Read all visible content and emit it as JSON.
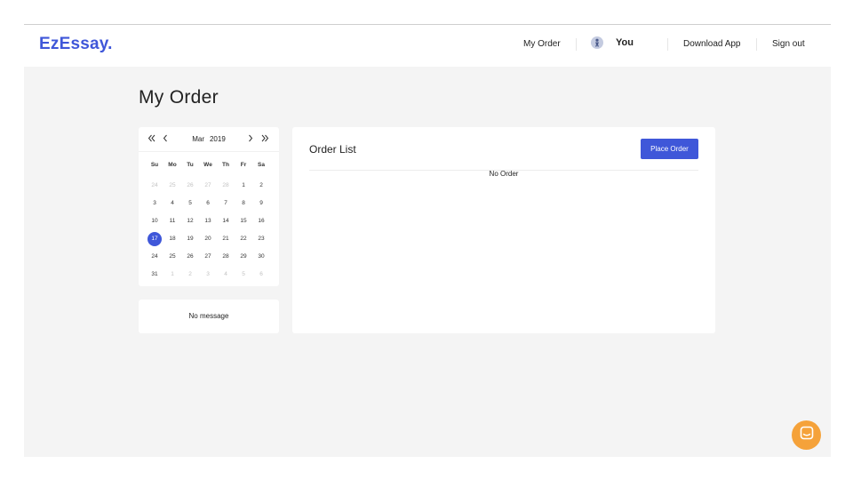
{
  "header": {
    "logo": "EzEssay.",
    "nav": {
      "my_order": "My Order",
      "user_name": "You",
      "download_app": "Download App",
      "sign_out": "Sign out"
    }
  },
  "page_title": "My Order",
  "calendar": {
    "month": "Mar",
    "year": "2019",
    "weekdays": [
      "Su",
      "Mo",
      "Tu",
      "We",
      "Th",
      "Fr",
      "Sa"
    ],
    "days": [
      {
        "d": "24",
        "muted": true
      },
      {
        "d": "25",
        "muted": true
      },
      {
        "d": "26",
        "muted": true
      },
      {
        "d": "27",
        "muted": true
      },
      {
        "d": "28",
        "muted": true
      },
      {
        "d": "1"
      },
      {
        "d": "2"
      },
      {
        "d": "3"
      },
      {
        "d": "4"
      },
      {
        "d": "5"
      },
      {
        "d": "6"
      },
      {
        "d": "7"
      },
      {
        "d": "8"
      },
      {
        "d": "9"
      },
      {
        "d": "10"
      },
      {
        "d": "11"
      },
      {
        "d": "12"
      },
      {
        "d": "13"
      },
      {
        "d": "14"
      },
      {
        "d": "15"
      },
      {
        "d": "16"
      },
      {
        "d": "17",
        "selected": true
      },
      {
        "d": "18"
      },
      {
        "d": "19"
      },
      {
        "d": "20"
      },
      {
        "d": "21"
      },
      {
        "d": "22"
      },
      {
        "d": "23"
      },
      {
        "d": "24"
      },
      {
        "d": "25"
      },
      {
        "d": "26"
      },
      {
        "d": "27"
      },
      {
        "d": "28"
      },
      {
        "d": "29"
      },
      {
        "d": "30"
      },
      {
        "d": "31"
      },
      {
        "d": "1",
        "muted": true
      },
      {
        "d": "2",
        "muted": true
      },
      {
        "d": "3",
        "muted": true
      },
      {
        "d": "4",
        "muted": true
      },
      {
        "d": "5",
        "muted": true
      },
      {
        "d": "6",
        "muted": true
      }
    ],
    "nav_icons": [
      "double-chevron-left-icon",
      "chevron-left-icon",
      "chevron-right-icon",
      "double-chevron-right-icon"
    ]
  },
  "messages": {
    "empty_text": "No message"
  },
  "orders": {
    "title": "Order List",
    "place_order_label": "Place Order",
    "empty_text": "No Order"
  },
  "colors": {
    "accent": "#3f57d9",
    "chat_button": "#f5a23a",
    "background": "#f4f4f4"
  },
  "chat": {
    "icon": "chat-bubble-icon"
  }
}
